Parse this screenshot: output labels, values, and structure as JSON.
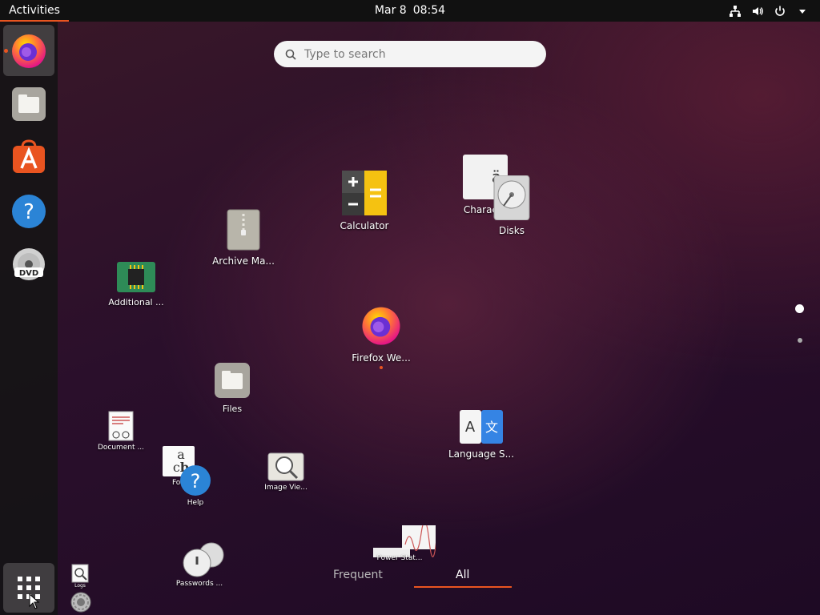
{
  "topbar": {
    "activities": "Activities",
    "date": "Mar 8",
    "time": "08:54",
    "tray_icons": [
      "network-icon",
      "volume-icon",
      "power-icon",
      "dropdown-icon"
    ]
  },
  "dock": {
    "items": [
      {
        "name": "firefox",
        "icon": "firefox-icon",
        "running": true
      },
      {
        "name": "files",
        "icon": "files-icon"
      },
      {
        "name": "software",
        "icon": "ubuntu-software-icon"
      },
      {
        "name": "help",
        "icon": "help-icon"
      },
      {
        "name": "dvd",
        "icon": "dvd-icon"
      }
    ],
    "show_apps_icon": "show-applications-icon"
  },
  "search": {
    "placeholder": "Type to search"
  },
  "apps": {
    "calculator": "Calculator",
    "characters": "Characte",
    "disks": "Disks",
    "archive": "Archive Ma...",
    "additional": "Additional ...",
    "firefox": "Firefox We...",
    "files": "Files",
    "document": "Document ...",
    "fonts": "Fon",
    "help": "Help",
    "image_viewer": "Image Vie...",
    "language": "Language S...",
    "passwords": "Passwords ...",
    "power": "Power Stat...",
    "logs": "Logs",
    "settings": "Settings"
  },
  "tabs": {
    "frequent": "Frequent",
    "all": "All",
    "active": "All"
  },
  "colors": {
    "accent": "#e95420",
    "topbar": "#111111"
  }
}
